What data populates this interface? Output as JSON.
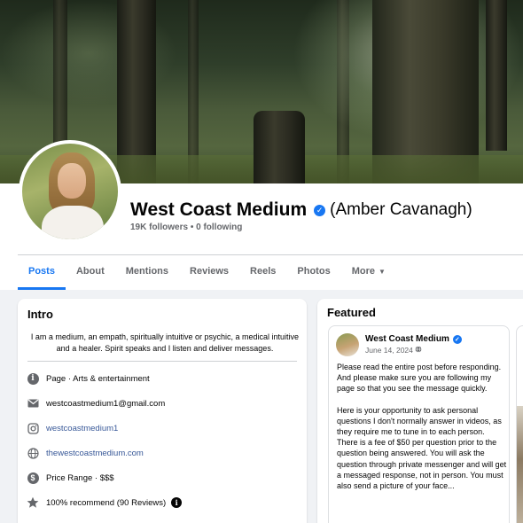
{
  "page": {
    "name": "West Coast Medium",
    "subtitle": "(Amber Cavanagh)",
    "followers": "19K followers",
    "following": "0 following",
    "separator": "•",
    "colors": {
      "accent": "#1877f2",
      "link": "#385898",
      "muted": "#65676b",
      "background": "#f0f2f5"
    }
  },
  "tabs": [
    {
      "label": "Posts",
      "active": true
    },
    {
      "label": "About"
    },
    {
      "label": "Mentions"
    },
    {
      "label": "Reviews"
    },
    {
      "label": "Reels"
    },
    {
      "label": "Photos"
    },
    {
      "label": "More"
    }
  ],
  "intro": {
    "title": "Intro",
    "bio": "I am a medium, an empath, spiritually intuitive or psychic, a medical intuitive and a healer. Spirit speaks and I listen and deliver messages.",
    "items": [
      {
        "icon": "info-icon",
        "text": "Page · Arts & entertainment"
      },
      {
        "icon": "email-icon",
        "text": "westcoastmedium1@gmail.com"
      },
      {
        "icon": "instagram-icon",
        "text": "westcoastmedium1"
      },
      {
        "icon": "globe-icon",
        "text": "thewestcoastmedium.com"
      },
      {
        "icon": "dollar-icon",
        "text": "Price Range · $$$"
      },
      {
        "icon": "star-icon",
        "text": "100% recommend (90 Reviews)"
      }
    ]
  },
  "featured": {
    "title": "Featured",
    "post": {
      "author": "West Coast Medium",
      "date": "June 14, 2024",
      "paragraphs": [
        "Please read the entire post before responding. And please make sure you are following my page so that you see the message quickly.",
        "Here is your opportunity to ask personal questions I don't normally answer in videos, as they require me to tune in to each person. There is a fee of $50 per question prior to the question being answered. You will ask the question through private messenger and will get a messaged response, not in person. You must also send a picture of your face..."
      ]
    }
  }
}
